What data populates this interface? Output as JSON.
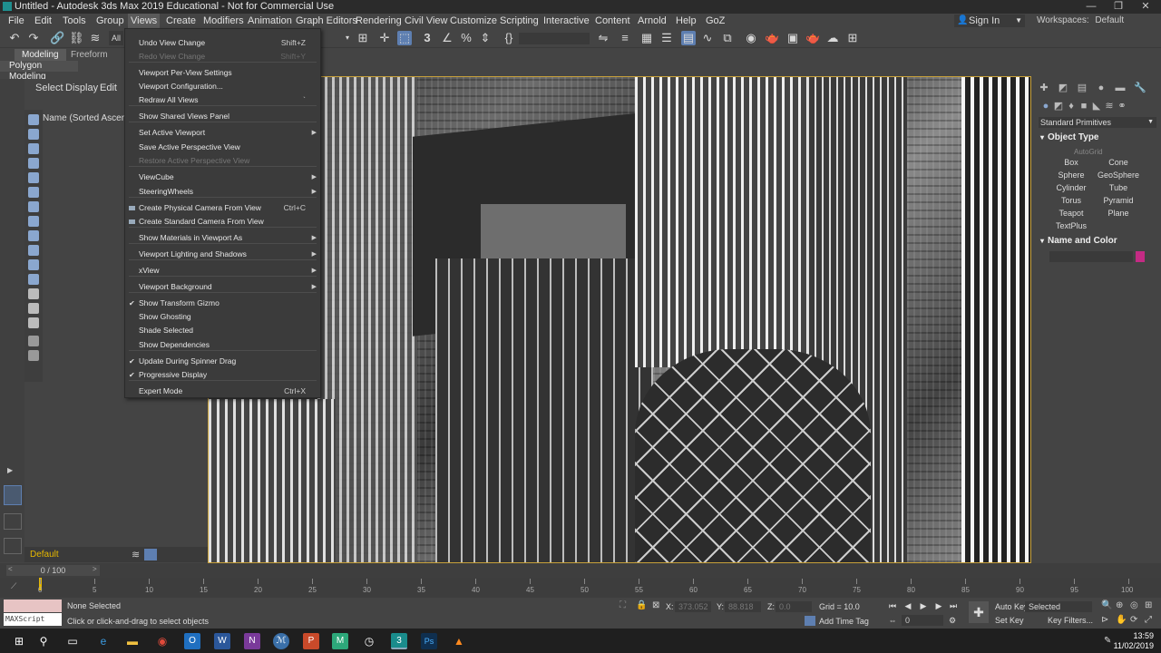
{
  "window": {
    "title": "Untitled - Autodesk 3ds Max 2019 Educational - Not for Commercial Use",
    "minimize": "—",
    "restore": "❐",
    "close": "✕"
  },
  "menubar": {
    "items": [
      "File",
      "Edit",
      "Tools",
      "Group",
      "Views",
      "Create",
      "Modifiers",
      "Animation",
      "Graph Editors",
      "Rendering",
      "Civil View",
      "Customize",
      "Scripting",
      "Interactive",
      "Content",
      "Arnold",
      "Help",
      "GoZ"
    ],
    "signin": "Sign In",
    "workspaces_label": "Workspaces:",
    "workspaces_value": "Default"
  },
  "toolbar": {
    "all_label": "All"
  },
  "ribbon": {
    "tabs": [
      "Modeling",
      "Freeform"
    ],
    "active_panel": "Polygon Modeling"
  },
  "explorer": {
    "tabs": [
      "Select",
      "Display",
      "Edit"
    ],
    "header": "Name (Sorted Ascending)",
    "layer": "Default"
  },
  "views_menu": {
    "items": [
      {
        "label": "Undo View Change",
        "shortcut": "Shift+Z",
        "disabled": false
      },
      {
        "label": "Redo View Change",
        "shortcut": "Shift+Y",
        "disabled": true
      },
      {
        "label": "Viewport Per-View Settings",
        "shortcut": "",
        "disabled": false
      },
      {
        "label": "Viewport Configuration...",
        "shortcut": "",
        "disabled": false
      },
      {
        "label": "Redraw All Views",
        "shortcut": "`",
        "disabled": false
      },
      {
        "label": "Show Shared Views Panel",
        "shortcut": "",
        "disabled": false
      },
      {
        "label": "Set Active Viewport",
        "shortcut": "",
        "disabled": false,
        "submenu": true
      },
      {
        "label": "Save Active Perspective View",
        "shortcut": "",
        "disabled": false
      },
      {
        "label": "Restore Active Perspective View",
        "shortcut": "",
        "disabled": true
      },
      {
        "label": "ViewCube",
        "shortcut": "",
        "disabled": false,
        "submenu": true
      },
      {
        "label": "SteeringWheels",
        "shortcut": "",
        "disabled": false,
        "submenu": true
      },
      {
        "label": "Create Physical Camera From View",
        "shortcut": "Ctrl+C",
        "disabled": false,
        "camera": true
      },
      {
        "label": "Create Standard Camera From View",
        "shortcut": "",
        "disabled": false,
        "camera": true
      },
      {
        "label": "Show Materials in Viewport As",
        "shortcut": "",
        "disabled": false,
        "submenu": true
      },
      {
        "label": "Viewport Lighting and Shadows",
        "shortcut": "",
        "disabled": false,
        "submenu": true
      },
      {
        "label": "xView",
        "shortcut": "",
        "disabled": false,
        "submenu": true
      },
      {
        "label": "Viewport Background",
        "shortcut": "",
        "disabled": false,
        "submenu": true
      },
      {
        "label": "Show Transform Gizmo",
        "shortcut": "",
        "disabled": false,
        "checked": true
      },
      {
        "label": "Show Ghosting",
        "shortcut": "",
        "disabled": false
      },
      {
        "label": "Shade Selected",
        "shortcut": "",
        "disabled": false
      },
      {
        "label": "Show Dependencies",
        "shortcut": "",
        "disabled": false
      },
      {
        "label": "Update During Spinner Drag",
        "shortcut": "",
        "disabled": false,
        "checked": true
      },
      {
        "label": "Progressive Display",
        "shortcut": "",
        "disabled": false,
        "checked": true
      },
      {
        "label": "Expert Mode",
        "shortcut": "Ctrl+X",
        "disabled": false
      }
    ]
  },
  "command_panel": {
    "category": "Standard Primitives",
    "object_type_title": "Object Type",
    "autogrid": "AutoGrid",
    "buttons": [
      "Box",
      "Cone",
      "Sphere",
      "GeoSphere",
      "Cylinder",
      "Tube",
      "Torus",
      "Pyramid",
      "Teapot",
      "Plane",
      "TextPlus"
    ],
    "name_color_title": "Name and Color",
    "swatch_color": "#c42b84"
  },
  "timeline": {
    "frame_counter": "0 / 100",
    "ticks": [
      "0",
      "5",
      "10",
      "15",
      "20",
      "25",
      "30",
      "35",
      "40",
      "45",
      "50",
      "55",
      "60",
      "65",
      "70",
      "75",
      "80",
      "85",
      "90",
      "95",
      "100"
    ]
  },
  "status": {
    "maxscript": "MAXScript Mi:",
    "selection": "None Selected",
    "prompt": "Click or click-and-drag to select objects",
    "x_label": "X:",
    "x_value": "373.052",
    "y_label": "Y:",
    "y_value": "88.818",
    "z_label": "Z:",
    "z_value": "0.0",
    "grid": "Grid = 10.0",
    "add_time_tag": "Add Time Tag",
    "auto_key": "Auto Key",
    "set_key": "Set Key",
    "selected": "Selected",
    "key_filters": "Key Filters...",
    "frame": "0"
  },
  "taskbar": {
    "time": "13:59",
    "date": "11/02/2019"
  }
}
